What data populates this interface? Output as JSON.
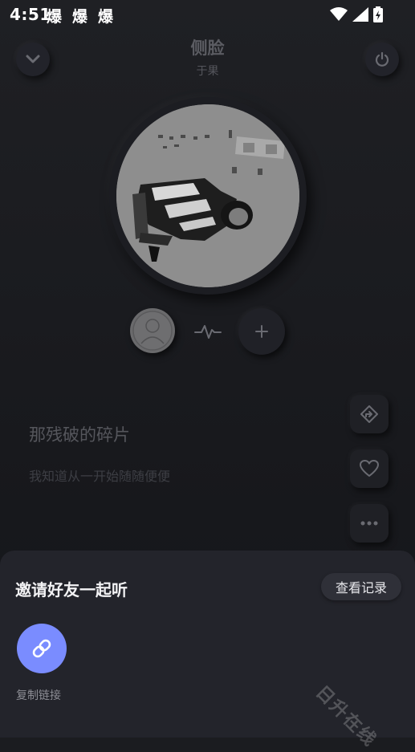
{
  "status_bar": {
    "time": "4:51",
    "notifications": [
      "爆",
      "爆",
      "爆"
    ]
  },
  "header": {
    "collapse_icon": "chevron-down-icon",
    "power_icon": "power-icon",
    "title": "侧脸",
    "artist": "于果"
  },
  "controls": {
    "avatar_icon": "person-placeholder-icon",
    "pulse_icon": "pulse-icon",
    "add_icon": "plus-icon"
  },
  "lyrics": {
    "current": "那残破的碎片",
    "next": "我知道从一开始随随便便"
  },
  "side_actions": [
    "share-icon",
    "heart-icon",
    "more-icon"
  ],
  "invite_sheet": {
    "title": "邀请好友一起听",
    "history_label": "查看记录",
    "copy_link_label": "复制链接",
    "watermark": "日升在线"
  },
  "colors": {
    "background": "#1b1c20",
    "sheet": "#23242b",
    "accent": "#7a8cff"
  }
}
